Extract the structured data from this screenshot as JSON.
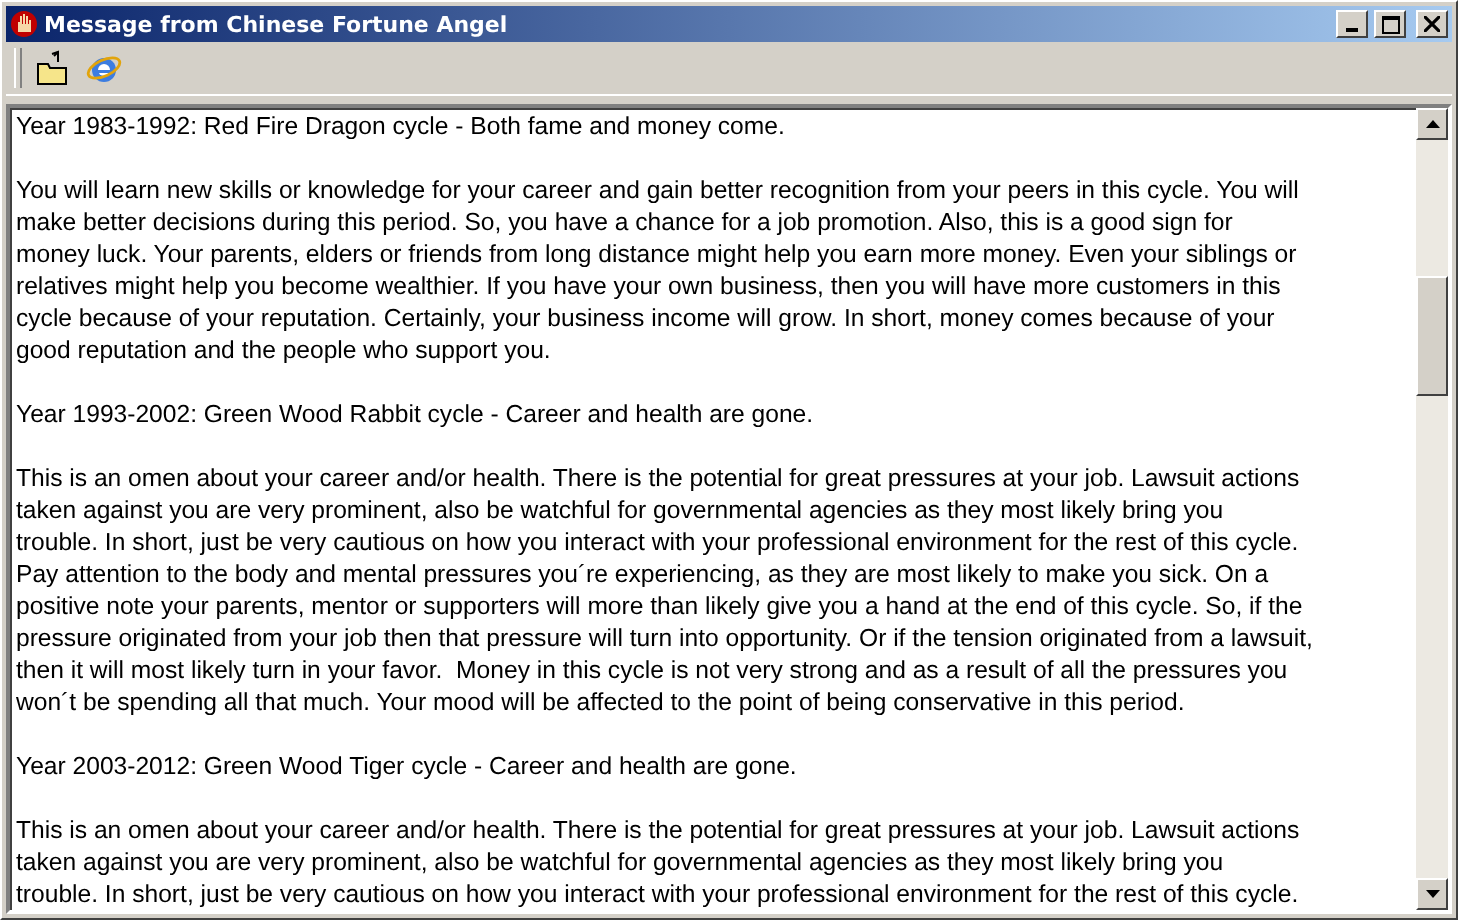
{
  "window": {
    "title": "Message from Chinese Fortune Angel"
  },
  "paragraphs": [
    {
      "lines": [
        "Year 1983-1992: Red Fire Dragon cycle - Both fame and money come."
      ]
    },
    {
      "lines": [
        "You will learn new skills or knowledge for your career and gain better recognition from your peers in this cycle. You will",
        "make better decisions during this period. So, you have a chance for a job promotion. Also, this is a good sign for",
        "money luck. Your parents, elders or friends from long distance might help you earn more money. Even your siblings or",
        "relatives might help you become wealthier. If you have your own business, then you will have more customers in this",
        "cycle because of your reputation. Certainly, your business income will grow. In short, money comes because of your",
        "good reputation and the people who support you."
      ]
    },
    {
      "lines": [
        "Year 1993-2002: Green Wood Rabbit cycle - Career and health are gone."
      ]
    },
    {
      "lines": [
        "This is an omen about your career and/or health. There is the potential for great pressures at your job. Lawsuit actions",
        "taken against you are very prominent, also be watchful for governmental agencies as they most likely bring you",
        "trouble. In short, just be very cautious on how you interact with your professional environment for the rest of this cycle.",
        "Pay attention to the body and mental pressures you´re experiencing, as they are most likely to make you sick. On a",
        "positive note your parents, mentor or supporters will more than likely give you a hand at the end of this cycle. So, if the",
        "pressure originated from your job then that pressure will turn into opportunity. Or if the tension originated from a lawsuit,",
        "then it will most likely turn in your favor.  Money in this cycle is not very strong and as a result of all the pressures you",
        "won´t be spending all that much. Your mood will be affected to the point of being conservative in this period."
      ]
    },
    {
      "lines": [
        "Year 2003-2012: Green Wood Tiger cycle - Career and health are gone."
      ]
    },
    {
      "lines": [
        "This is an omen about your career and/or health. There is the potential for great pressures at your job. Lawsuit actions",
        "taken against you are very prominent, also be watchful for governmental agencies as they most likely bring you",
        "trouble. In short, just be very cautious on how you interact with your professional environment for the rest of this cycle."
      ]
    }
  ]
}
